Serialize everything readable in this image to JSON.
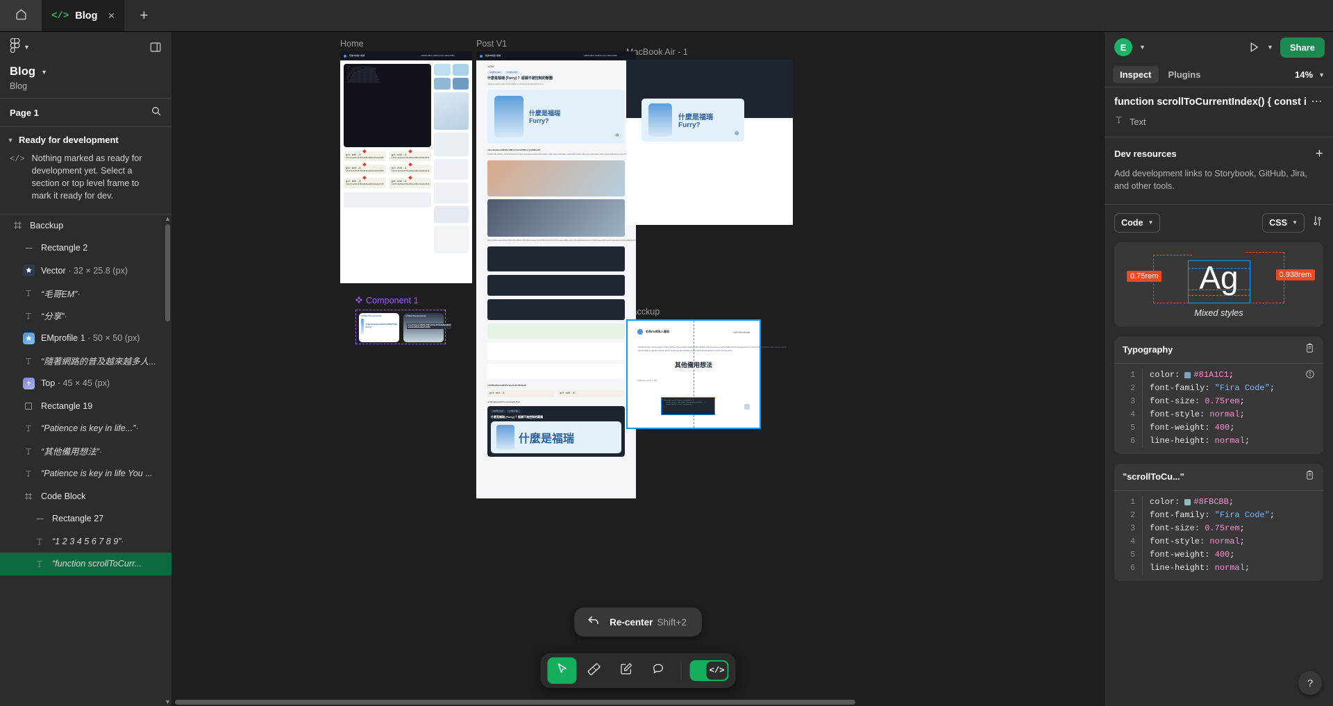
{
  "tabbar": {
    "home_icon": "home-icon",
    "tab": {
      "icon": "code-icon",
      "label": "Blog",
      "close": "×"
    },
    "new_tab": "+"
  },
  "left_panel": {
    "logo": "figma-logo-icon",
    "file_title": "Blog",
    "file_subtitle": "Blog",
    "page_name": "Page 1",
    "search_icon": "search-icon",
    "section": {
      "label": "Ready for development",
      "empty_icon": "code-icon",
      "empty_text": "Nothing marked as ready for development yet. Select a section or top level frame to mark it ready for dev."
    },
    "layers": [
      {
        "name": "Bacckup",
        "icon": "frame-icon",
        "meta": "",
        "type": "frame",
        "depth": 0,
        "selected": false
      },
      {
        "name": "Rectangle 2",
        "icon": "line-icon",
        "meta": "",
        "type": "shape",
        "depth": 1,
        "selected": false
      },
      {
        "name": "Vector",
        "icon": "image-thumb",
        "meta": " · 32 × 25.8 (px)",
        "type": "image",
        "depth": 1,
        "selected": false
      },
      {
        "name": "“毛哥EM”",
        "icon": "text-icon",
        "meta": "·",
        "type": "text",
        "depth": 1,
        "selected": false
      },
      {
        "name": "“分享”",
        "icon": "text-icon",
        "meta": "·",
        "type": "text",
        "depth": 1,
        "selected": false
      },
      {
        "name": "EMprofile 1",
        "icon": "image-thumb",
        "meta": " · 50 × 50 (px)",
        "type": "image",
        "depth": 1,
        "selected": false
      },
      {
        "name": "“隨著網路的普及越來越多人...",
        "icon": "text-icon",
        "meta": "",
        "type": "text",
        "depth": 1,
        "selected": false
      },
      {
        "name": "Top",
        "icon": "image-thumb",
        "meta": " · 45 × 45 (px)",
        "type": "image",
        "depth": 1,
        "selected": false
      },
      {
        "name": "Rectangle 19",
        "icon": "rect-icon",
        "meta": "",
        "type": "shape",
        "depth": 1,
        "selected": false
      },
      {
        "name": "“Patience is key in life...”",
        "icon": "text-icon",
        "meta": "·",
        "type": "text",
        "depth": 1,
        "selected": false
      },
      {
        "name": "“其他備用想法”",
        "icon": "text-icon",
        "meta": "·",
        "type": "text",
        "depth": 1,
        "selected": false
      },
      {
        "name": "“Patience is key in life You ...",
        "icon": "text-icon",
        "meta": "",
        "type": "text",
        "depth": 1,
        "selected": false
      },
      {
        "name": "Code Block",
        "icon": "component-icon",
        "meta": "",
        "type": "group",
        "depth": 1,
        "selected": false
      },
      {
        "name": "Rectangle 27",
        "icon": "line-icon",
        "meta": "",
        "type": "shape",
        "depth": 2,
        "selected": false
      },
      {
        "name": "“1 2 3 4 5 6 7 8 9”",
        "icon": "text-icon",
        "meta": "·",
        "type": "text",
        "depth": 2,
        "selected": false
      },
      {
        "name": "“function scrollToCurr...",
        "icon": "text-icon",
        "meta": "",
        "type": "text",
        "depth": 2,
        "selected": true
      }
    ]
  },
  "canvas": {
    "frames": [
      {
        "label": "Home"
      },
      {
        "label": "Post V1"
      },
      {
        "label": "MacBook Air - 1"
      },
      {
        "label": "Component 1",
        "is_component": true
      },
      {
        "label": "Bacckup"
      }
    ],
    "mock_text": {
      "site_name": "毛哥EM的私人基地",
      "post_title": "什麼是福瑞 (Furry) ？認識不被控制的獸園",
      "hero_line1": "什麼是福瑞",
      "hero_line2": "Furry?",
      "backup_title": "其他備用想法",
      "git_cmd": "git add -A"
    },
    "recenter": {
      "label": "Re-center",
      "shortcut": "Shift+2",
      "icon": "undo-arrow-icon"
    },
    "toolbar": [
      {
        "name": "move-tool",
        "icon": "cursor-icon",
        "active": true
      },
      {
        "name": "measure-tool",
        "icon": "ruler-icon",
        "active": false
      },
      {
        "name": "annotate-tool",
        "icon": "pencil-square-icon",
        "active": false
      },
      {
        "name": "comment-tool",
        "icon": "comment-icon",
        "active": false
      }
    ],
    "dev_toggle": {
      "name": "dev-mode-toggle",
      "icon": "code-icon",
      "on": true
    }
  },
  "right_panel": {
    "avatar_letter": "E",
    "play_icon": "play-icon",
    "share_label": "Share",
    "tabs": [
      {
        "label": "Inspect",
        "active": true
      },
      {
        "label": "Plugins",
        "active": false
      }
    ],
    "zoom": "14%",
    "selection": {
      "name": "function scrollToCurrentIndex() { const iter",
      "type_icon": "text-icon",
      "type_label": "Text",
      "more_icon": "ellipsis-icon"
    },
    "dev_resources": {
      "title": "Dev resources",
      "add_icon": "plus-icon",
      "description": "Add development links to Storybook, GitHub, Jira, and other tools."
    },
    "controls": {
      "code_select": "Code",
      "lang_select": "CSS",
      "settings_icon": "sliders-icon"
    },
    "typography_preview": {
      "glyph": "Ag",
      "left_badge": "0.75rem",
      "right_badge": "0.938rem",
      "caption": "Mixed styles",
      "blue": "#0d99ff",
      "red": "#f24822"
    },
    "code_blocks": [
      {
        "title": "Typography",
        "copy_icon": "clipboard-icon",
        "has_info": true,
        "swatch": "#81A1C1",
        "lines": [
          {
            "n": "1",
            "prop": "color:",
            "value": "#81A1C1",
            "kind": "color"
          },
          {
            "n": "2",
            "prop": "font-family:",
            "value": "\"Fira Code\"",
            "kind": "string"
          },
          {
            "n": "3",
            "prop": "font-size:",
            "value": "0.75rem",
            "kind": "num"
          },
          {
            "n": "4",
            "prop": "font-style:",
            "value": "normal",
            "kind": "kw"
          },
          {
            "n": "5",
            "prop": "font-weight:",
            "value": "400",
            "kind": "num"
          },
          {
            "n": "6",
            "prop": "line-height:",
            "value": "normal",
            "kind": "kw"
          }
        ]
      },
      {
        "title": "\"scrollToCu...\"",
        "copy_icon": "clipboard-icon",
        "has_info": false,
        "swatch": "#8FBCBB",
        "lines": [
          {
            "n": "1",
            "prop": "color:",
            "value": "#8FBCBB",
            "kind": "color"
          },
          {
            "n": "2",
            "prop": "font-family:",
            "value": "\"Fira Code\"",
            "kind": "string"
          },
          {
            "n": "3",
            "prop": "font-size:",
            "value": "0.75rem",
            "kind": "num"
          },
          {
            "n": "4",
            "prop": "font-style:",
            "value": "normal",
            "kind": "kw"
          },
          {
            "n": "5",
            "prop": "font-weight:",
            "value": "400",
            "kind": "num"
          },
          {
            "n": "6",
            "prop": "line-height:",
            "value": "normal",
            "kind": "kw"
          }
        ]
      }
    ],
    "help_label": "?"
  }
}
